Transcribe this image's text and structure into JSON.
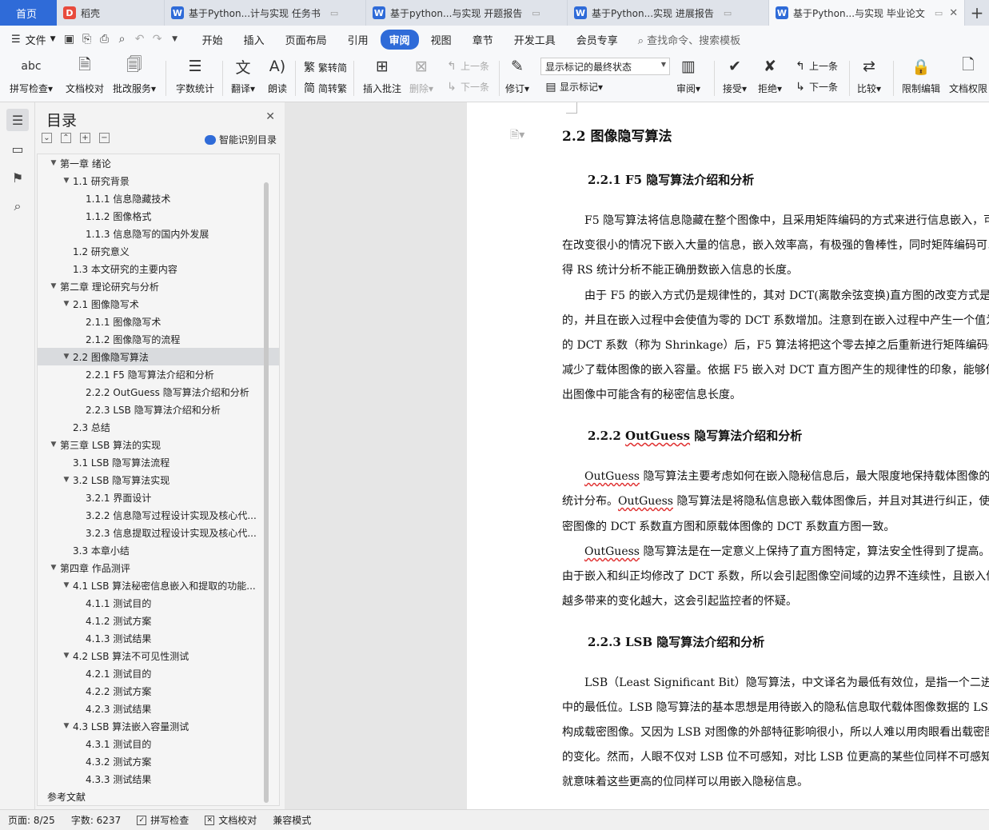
{
  "tabs": {
    "home": "首页",
    "docer": "稻壳",
    "docs": [
      {
        "title": "基于Python...计与实现 任务书"
      },
      {
        "title": "基于python...与实现 开题报告"
      },
      {
        "title": "基于Python...实现 进展报告"
      },
      {
        "title": "基于Python...与实现 毕业论文"
      }
    ]
  },
  "menu": {
    "file": "文件",
    "items": [
      "开始",
      "插入",
      "页面布局",
      "引用",
      "审阅",
      "视图",
      "章节",
      "开发工具",
      "会员专享"
    ],
    "active": "审阅",
    "search_placeholder": "查找命令、搜索模板"
  },
  "ribbon": {
    "spellcheck": "拼写检查",
    "doc_proof": "文档校对",
    "correction": "批改服务",
    "word_count": "字数统计",
    "translate": "翻译",
    "read_aloud": "朗读",
    "trad": "繁转简",
    "simp": "简转繁",
    "insert_comment": "插入批注",
    "delete": "删除",
    "prev": "上一条",
    "next": "下一条",
    "revise": "修订",
    "markup_select": "显示标记的最终状态",
    "show_markup": "显示标记",
    "review": "审阅",
    "accept": "接受",
    "reject": "拒绝",
    "prev2": "上一条",
    "next2": "下一条",
    "compare": "比较",
    "restrict": "限制编辑",
    "permission": "文档权限"
  },
  "toc": {
    "title": "目录",
    "smart": "智能识别目录",
    "items": [
      {
        "text": "第一章  绪论",
        "level": 0,
        "caret": "v"
      },
      {
        "text": "1.1  研究背景",
        "level": 1,
        "caret": "v"
      },
      {
        "text": "1.1.1  信息隐藏技术",
        "level": 2
      },
      {
        "text": "1.1.2  图像格式",
        "level": 2
      },
      {
        "text": "1.1.3  信息隐写的国内外发展",
        "level": 2
      },
      {
        "text": "1.2  研究意义",
        "level": 1
      },
      {
        "text": "1.3  本文研究的主要内容",
        "level": 1
      },
      {
        "text": "第二章  理论研究与分析",
        "level": 0,
        "caret": "v"
      },
      {
        "text": "2.1  图像隐写术",
        "level": 1,
        "caret": "v"
      },
      {
        "text": "2.1.1  图像隐写术",
        "level": 2
      },
      {
        "text": "2.1.2  图像隐写的流程",
        "level": 2
      },
      {
        "text": "2.2 图像隐写算法",
        "level": 1,
        "caret": "v",
        "selected": true
      },
      {
        "text": "2.2.1 F5 隐写算法介绍和分析",
        "level": 2
      },
      {
        "text": "2.2.2 OutGuess 隐写算法介绍和分析",
        "level": 2
      },
      {
        "text": "2.2.3 LSB 隐写算法介绍和分析",
        "level": 2
      },
      {
        "text": "2.3  总结",
        "level": 1
      },
      {
        "text": "第三章  LSB 算法的实现",
        "level": 0,
        "caret": "v"
      },
      {
        "text": "3.1 LSB 隐写算法流程",
        "level": 1
      },
      {
        "text": "3.2 LSB 隐写算法实现",
        "level": 1,
        "caret": "v"
      },
      {
        "text": "3.2.1  界面设计",
        "level": 2
      },
      {
        "text": "3.2.2  信息隐写过程设计实现及核心代...",
        "level": 2
      },
      {
        "text": "3.2.3  信息提取过程设计实现及核心代...",
        "level": 2
      },
      {
        "text": "3.3 本章小结",
        "level": 1
      },
      {
        "text": "第四章  作品测评",
        "level": 0,
        "caret": "v"
      },
      {
        "text": "4.1 LSB 算法秘密信息嵌入和提取的功能...",
        "level": 1,
        "caret": "v"
      },
      {
        "text": "4.1.1  测试目的",
        "level": 2
      },
      {
        "text": "4.1.2  测试方案",
        "level": 2
      },
      {
        "text": "4.1.3  测试结果",
        "level": 2
      },
      {
        "text": "4.2 LSB 算法不可见性测试",
        "level": 1,
        "caret": "v"
      },
      {
        "text": "4.2.1  测试目的",
        "level": 2
      },
      {
        "text": "4.2.2  测试方案",
        "level": 2
      },
      {
        "text": "4.2.3 测试结果",
        "level": 2
      },
      {
        "text": "4.3 LSB 算法嵌入容量测试",
        "level": 1,
        "caret": "v"
      },
      {
        "text": "4.3.1  测试目的",
        "level": 2
      },
      {
        "text": "4.3.2  测试方案",
        "level": 2
      },
      {
        "text": "4.3.3  测试结果",
        "level": 2
      },
      {
        "text": "参考文献",
        "level": 0
      }
    ]
  },
  "doc": {
    "h_2_2": "2.2 图像隐写算法",
    "h_2_2_1": "2.2.1 F5 隐写算法介绍和分析",
    "f5_lines": [
      "F5 隐写算法将信息隐藏在整个图像中，且采用矩阵编码的方式来进行信息嵌入，可",
      "在改变很小的情况下嵌入大量的信息，嵌入效率高，有极强的鲁棒性，同时矩阵编码可以",
      "得 RS 统计分析不能正确册数嵌入信息的长度。",
      "由于 F5 的嵌入方式仍是规律性的，其对 DCT(离散余弦变换)直方图的改变方式是固",
      "的，并且在嵌入过程中会使值为零的 DCT 系数增加。注意到在嵌入过程中产生一个值为",
      "的 DCT 系数（称为 Shrinkage）后，F5 算法将把这个零去掉之后重新进行矩阵编码并嵌",
      "减少了载体图像的嵌入容量。依据 F5 嵌入对 DCT 直方图产生的规律性的印象，能够估",
      "出图像中可能含有的秘密信息长度。"
    ],
    "h_2_2_2_num": "2.2.2",
    "h_2_2_2_word": "OutGuess",
    "h_2_2_2_rest": "隐写算法介绍和分析",
    "og": {
      "word": "OutGuess",
      "l1_rest": "隐写算法主要考虑如何在嵌入隐秘信息后，最大限度地保持载体图像的概",
      "l2_pre": "统计分布。",
      "l2_rest": "隐写算法是将隐私信息嵌入载体图像后，并且对其进行纠正，使得",
      "l3": "密图像的 DCT 系数直方图和原载体图像的 DCT 系数直方图一致。",
      "l4_rest": "隐写算法是在一定意义上保持了直方图特定，算法安全性得到了提高。但",
      "l5": "由于嵌入和纠正均修改了 DCT 系数，所以会引起图像空间域的边界不连续性，且嵌入信",
      "l6": "越多带来的变化越大，这会引起监控者的怀疑。"
    },
    "h_2_2_3": "2.2.3 LSB 隐写算法介绍和分析",
    "lsb_lines": [
      "LSB（Least Significant Bit）隐写算法，中文译名为最低有效位，是指一个二进制数",
      "中的最低位。LSB 隐写算法的基本思想是用待嵌入的隐私信息取代载体图像数据的 LSB",
      "构成载密图像。又因为 LSB 对图像的外部特征影响很小，所以人难以用肉眼看出载密图",
      "的变化。然而，人眼不仅对 LSB 位不可感知，对比 LSB 位更高的某些位同样不可感知，",
      "就意味着这些更高的位同样可以用嵌入隐秘信息。"
    ]
  },
  "status": {
    "page": "页面: 8/25",
    "words": "字数: 6237",
    "spell": "拼写检查",
    "proof": "文档校对",
    "compat": "兼容模式"
  },
  "colors": {
    "accent": "#2f6bd8",
    "spell_underline": "#e03030"
  }
}
